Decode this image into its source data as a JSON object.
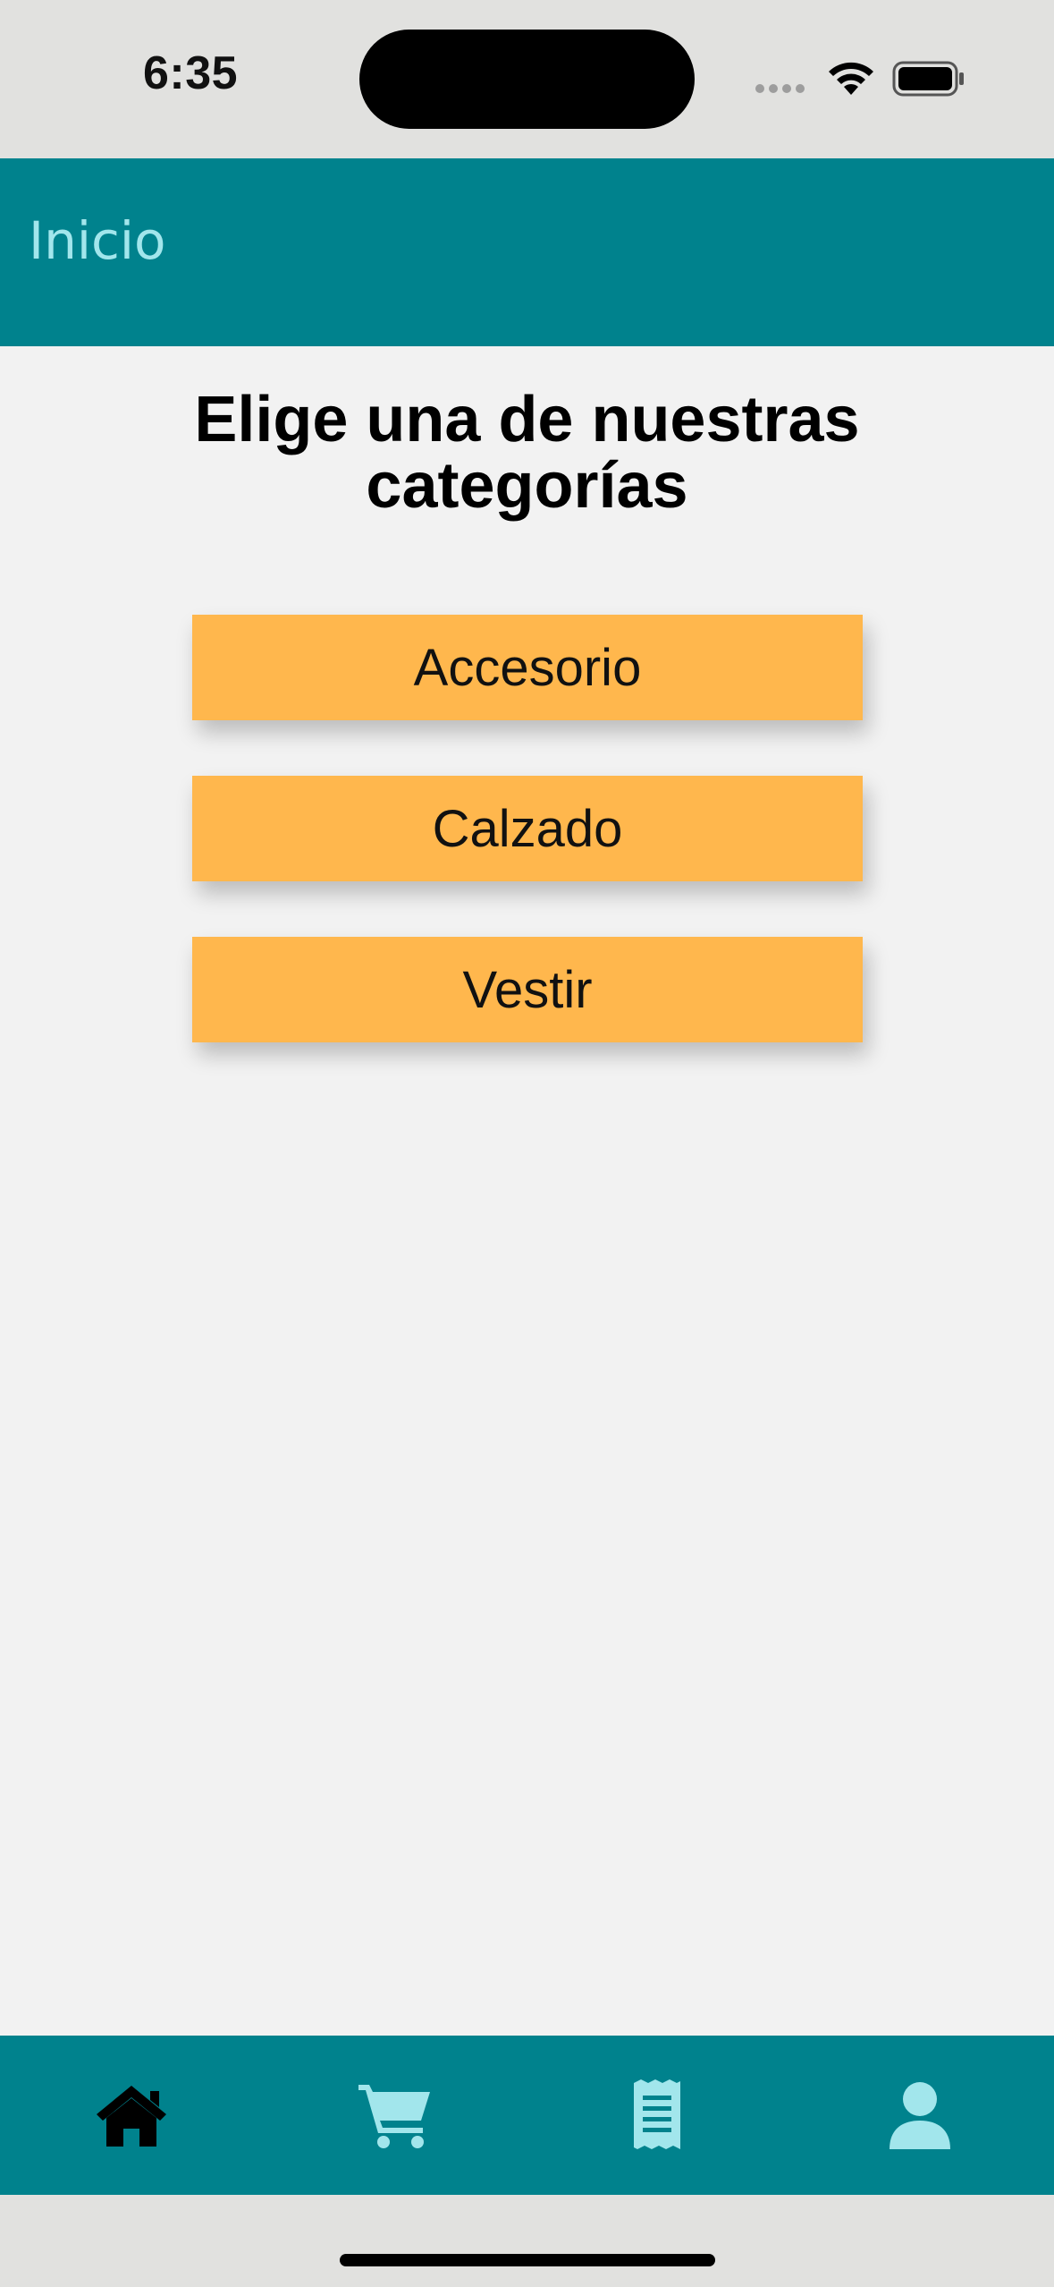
{
  "status_bar": {
    "time": "6:35"
  },
  "app_bar": {
    "title": "Inicio"
  },
  "main": {
    "heading_line1": "Elige una de nuestras",
    "heading_line2": "categorías",
    "categories": [
      "Accesorio",
      "Calzado",
      "Vestir"
    ]
  },
  "bottom_nav": {
    "items": [
      {
        "icon": "home-icon",
        "active": true
      },
      {
        "icon": "cart-icon",
        "active": false
      },
      {
        "icon": "receipt-icon",
        "active": false
      },
      {
        "icon": "user-icon",
        "active": false
      }
    ]
  },
  "colors": {
    "primary": "#00828d",
    "title_text": "#a2e6ec",
    "button": "#ffb74d",
    "nav_inactive": "#a2e6ec",
    "nav_active": "#000000",
    "background": "#f2f2f2"
  }
}
